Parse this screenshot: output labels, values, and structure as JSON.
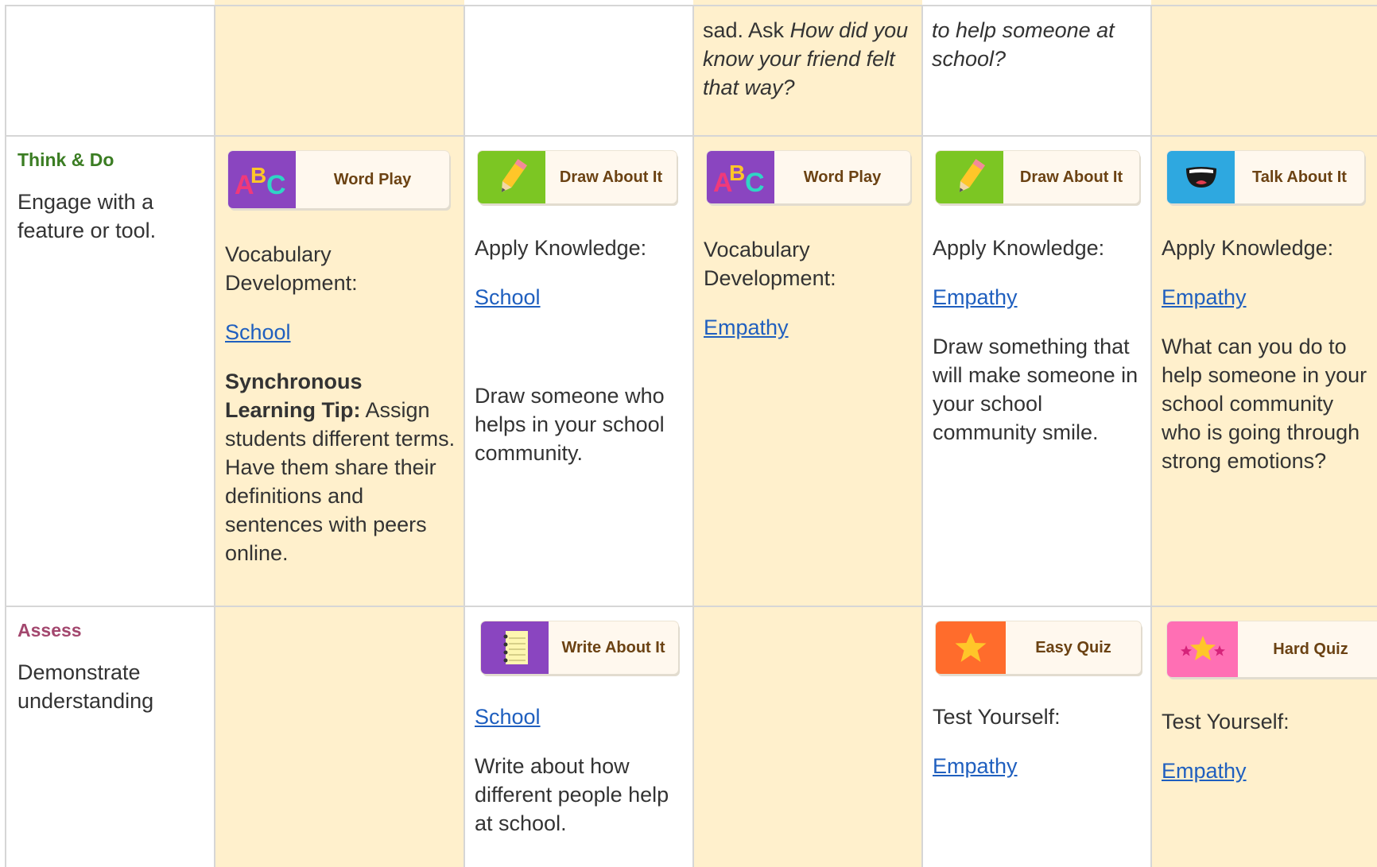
{
  "colors": {
    "cream": "#fff0cc",
    "grid": "#d6d6d6",
    "think_green": "#3b7d23",
    "assess_pink": "#a3476e",
    "link": "#1f5fbf"
  },
  "top_row": {
    "col4": {
      "lead": "sad. Ask ",
      "italic": "How did you know your friend felt that way?"
    },
    "col5": {
      "italic": "to help someone at school?"
    }
  },
  "think_row": {
    "label": "Think & Do",
    "desc": "Engage with a feature or tool.",
    "c1": {
      "badge": "Word Play",
      "heading": "Vocabulary Development:",
      "link": "School",
      "tip_bold": "Synchronous Learning Tip:",
      "tip_text": " Assign students different terms. Have them share their definitions and sentences with peers online."
    },
    "c2": {
      "badge": "Draw About It",
      "heading": "Apply Knowledge:",
      "link": "School",
      "prompt": "Draw someone who helps in your school community."
    },
    "c3": {
      "badge": "Word Play",
      "heading": "Vocabulary Development:",
      "link": "Empathy"
    },
    "c4": {
      "badge": "Draw About It",
      "heading": "Apply Knowledge:",
      "link": "Empathy",
      "prompt": "Draw something that will make someone in your school community smile."
    },
    "c5": {
      "badge": "Talk About It",
      "heading": "Apply Knowledge:",
      "link": "Empathy",
      "prompt": "What can you do to help someone in your school community who is going through strong emotions?"
    }
  },
  "assess_row": {
    "label": "Assess",
    "desc": "Demonstrate understanding",
    "c2": {
      "badge": "Write About It",
      "link": "School",
      "prompt": "Write about how different people help at school."
    },
    "c4": {
      "badge": "Easy Quiz",
      "heading": "Test Yourself:",
      "link": "Empathy"
    },
    "c5": {
      "badge": "Hard Quiz",
      "heading": "Test Yourself:",
      "link": "Empathy"
    }
  },
  "icons": [
    "abc-letters-icon",
    "pencil-icon",
    "talking-mouth-icon",
    "notebook-icon",
    "star-icon",
    "stars-icon"
  ]
}
